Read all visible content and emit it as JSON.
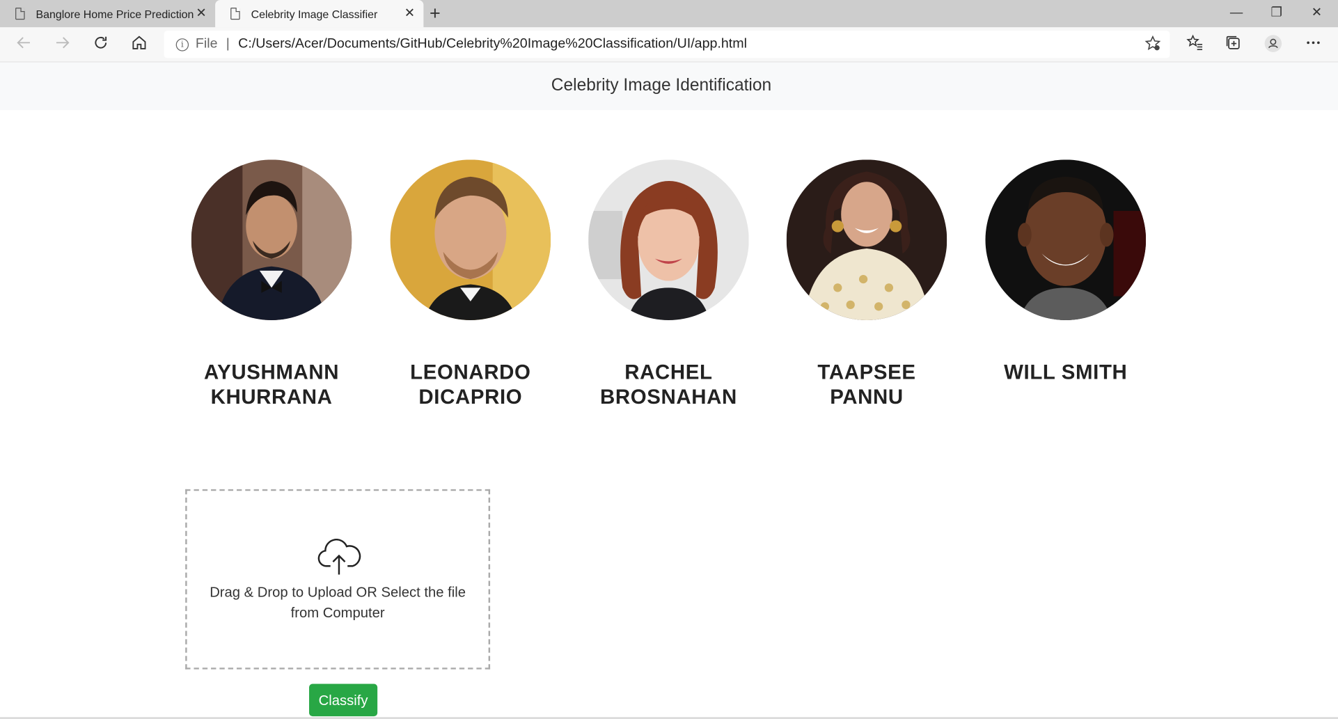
{
  "browser": {
    "tabs": [
      {
        "label": "Banglore Home Price Prediction",
        "active": false
      },
      {
        "label": "Celebrity Image Classifier",
        "active": true
      }
    ],
    "new_tab_glyph": "+",
    "close_glyph": "✕",
    "window_controls": {
      "minimize": "—",
      "restore": "❐",
      "close": "✕"
    },
    "address": {
      "scheme_label": "File",
      "separator": "|",
      "url": "C:/Users/Acer/Documents/GitHub/Celebrity%20Image%20Classification/UI/app.html"
    }
  },
  "page": {
    "title": "Celebrity Image Identification",
    "celebrities": [
      {
        "name_line1": "AYUSHMANN",
        "name_line2": "KHURRANA"
      },
      {
        "name_line1": "LEONARDO",
        "name_line2": "DICAPRIO"
      },
      {
        "name_line1": "RACHEL",
        "name_line2": "BROSNAHAN"
      },
      {
        "name_line1": "TAAPSEE",
        "name_line2": "PANNU"
      },
      {
        "name_line1": "WILL SMITH",
        "name_line2": ""
      }
    ],
    "dropzone": {
      "text": "Drag & Drop to Upload OR Select the file from Computer"
    },
    "classify_button": "Classify"
  },
  "colors": {
    "button_green": "#28a745",
    "header_bg": "#f8f9fa",
    "tabbar_bg": "#cdcdcd"
  }
}
